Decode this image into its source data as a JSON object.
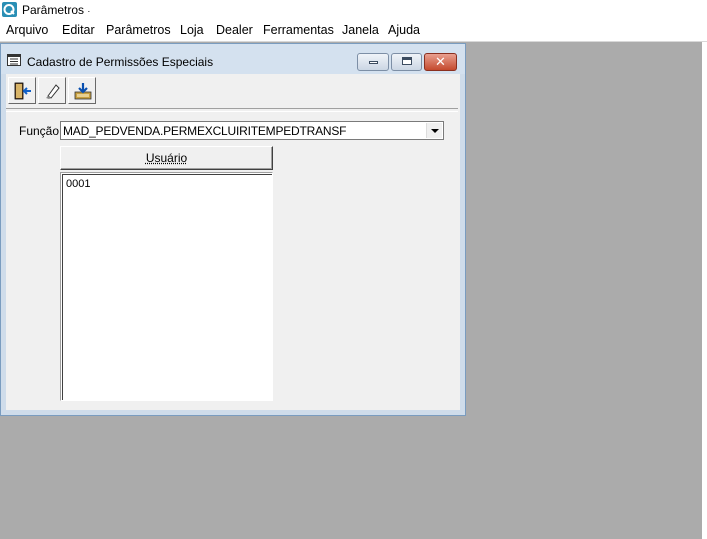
{
  "app": {
    "title": "Parâmetros",
    "title_suffix": "·"
  },
  "menu": {
    "items": [
      "Arquivo",
      "Editar",
      "Parâmetros",
      "Loja",
      "Dealer",
      "Ferramentas",
      "Janela",
      "Ajuda"
    ]
  },
  "window": {
    "title": "Cadastro de Permissões Especiais",
    "close_glyph": "✕"
  },
  "toolbar": {
    "buttons": [
      {
        "icon": "exit-door-icon"
      },
      {
        "icon": "eraser-icon"
      },
      {
        "icon": "save-download-icon"
      }
    ]
  },
  "form": {
    "funcao_label": "Função",
    "funcao_value": "MAD_PEDVENDA.PERMEXCLUIRITEMPEDTRANSF",
    "column_header": "Usuário",
    "users": [
      "0001"
    ]
  },
  "colors": {
    "workspace": "#ababab",
    "window_frame": "#cfdcea",
    "client": "#f0f0f0",
    "close_button": "#c44a2e"
  }
}
